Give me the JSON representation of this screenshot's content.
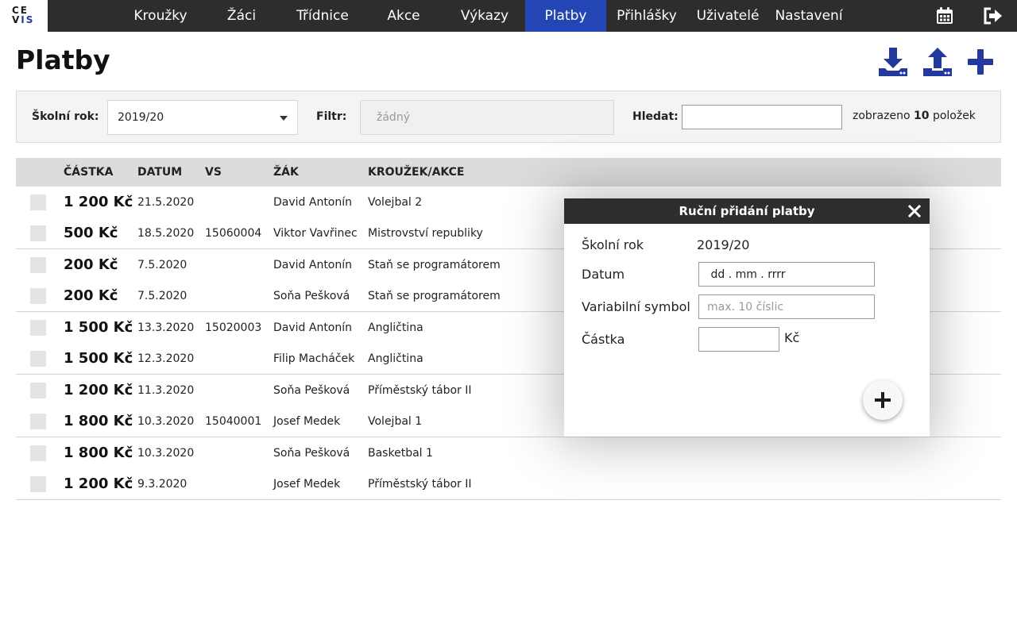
{
  "logo": {
    "line1": "CE",
    "line2a": "V",
    "line2b": "IS"
  },
  "nav": {
    "items": [
      {
        "label": "Kroužky",
        "active": false
      },
      {
        "label": "Žáci",
        "active": false
      },
      {
        "label": "Třídnice",
        "active": false
      },
      {
        "label": "Akce",
        "active": false
      },
      {
        "label": "Výkazy",
        "active": false
      },
      {
        "label": "Platby",
        "active": true
      },
      {
        "label": "Přihlášky",
        "active": false
      },
      {
        "label": "Uživatelé",
        "active": false
      },
      {
        "label": "Nastavení",
        "active": false
      }
    ],
    "icons": [
      "calendar-icon",
      "logout-icon"
    ]
  },
  "page": {
    "title": "Platby",
    "actions": [
      "download-icon",
      "upload-icon",
      "plus-icon"
    ]
  },
  "filters": {
    "year_label": "Školní rok:",
    "year_value": "2019/20",
    "filter_label": "Filtr:",
    "filter_placeholder": "žádný",
    "search_label": "Hledat:",
    "search_value": "",
    "count_prefix": "zobrazeno",
    "count_value": "10",
    "count_suffix": "položek"
  },
  "table": {
    "headers": {
      "amount": "ČÁSTKA",
      "date": "DATUM",
      "vs": "VS",
      "student": "ŽÁK",
      "course": "KROUŽEK/AKCE"
    },
    "rows": [
      {
        "amount": "1 200 Kč",
        "date": "21.5.2020",
        "vs": "",
        "student": "David Antonín",
        "course": "Volejbal 2"
      },
      {
        "amount": "500 Kč",
        "date": "18.5.2020",
        "vs": "15060004",
        "student": "Viktor Vavřinec",
        "course": "Mistrovství republiky"
      },
      {
        "amount": "200 Kč",
        "date": "7.5.2020",
        "vs": "",
        "student": "David Antonín",
        "course": "Staň se programátorem"
      },
      {
        "amount": "200 Kč",
        "date": "7.5.2020",
        "vs": "",
        "student": "Soňa Pešková",
        "course": "Staň se programátorem"
      },
      {
        "amount": "1 500 Kč",
        "date": "13.3.2020",
        "vs": "15020003",
        "student": "David Antonín",
        "course": "Angličtina"
      },
      {
        "amount": "1 500 Kč",
        "date": "12.3.2020",
        "vs": "",
        "student": "Filip Macháček",
        "course": "Angličtina"
      },
      {
        "amount": "1 200 Kč",
        "date": "11.3.2020",
        "vs": "",
        "student": "Soňa Pešková",
        "course": "Příměstský tábor II"
      },
      {
        "amount": "1 800 Kč",
        "date": "10.3.2020",
        "vs": "15040001",
        "student": "Josef Medek",
        "course": "Volejbal 1"
      },
      {
        "amount": "1 800 Kč",
        "date": "10.3.2020",
        "vs": "",
        "student": "Soňa Pešková",
        "course": "Basketbal 1"
      },
      {
        "amount": "1 200 Kč",
        "date": "9.3.2020",
        "vs": "",
        "student": "Josef Medek",
        "course": "Příměstský tábor II"
      }
    ]
  },
  "modal": {
    "title": "Ruční přidání platby",
    "year_label": "Školní rok",
    "year_value": "2019/20",
    "date_label": "Datum",
    "date_value": " dd . mm . rrrr",
    "vs_label": "Variabilní symbol",
    "vs_placeholder": "max. 10 číslic",
    "amount_label": "Částka",
    "amount_value": "",
    "amount_unit": "Kč"
  },
  "colors": {
    "nav_bg": "#2d2d2d",
    "accent": "#2346b4",
    "icon_blue": "#2339a0"
  }
}
